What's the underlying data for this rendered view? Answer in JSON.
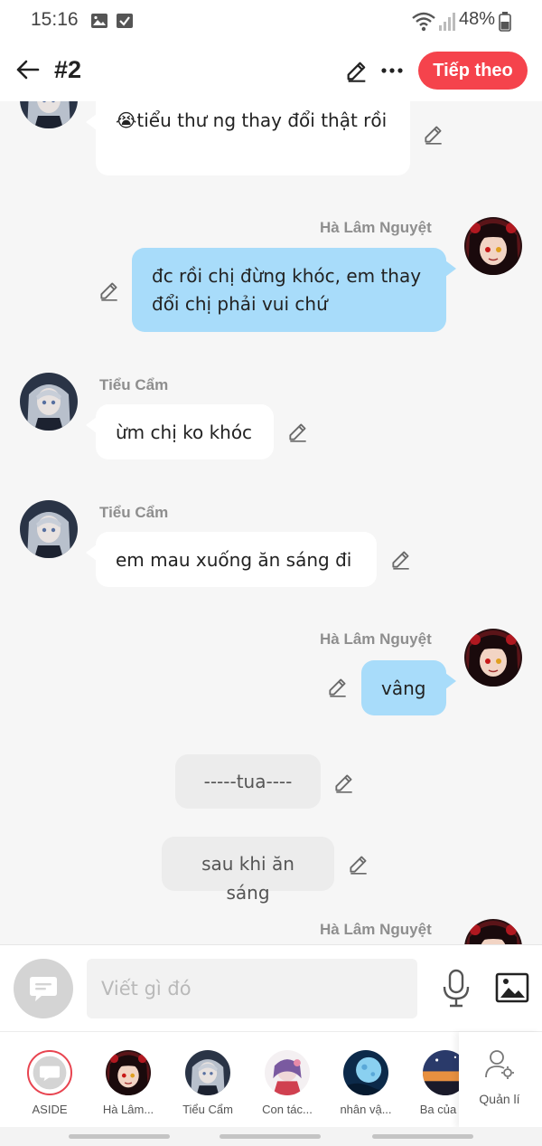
{
  "status_bar": {
    "time": "15:16",
    "battery": "48%"
  },
  "header": {
    "title": "#2",
    "next_label": "Tiếp theo"
  },
  "messages": [
    {
      "type": "left",
      "speaker": "",
      "text": "😭tiểu thư ng thay đổi thật rồi"
    },
    {
      "type": "right",
      "speaker": "Hà Lâm Nguyệt",
      "text": "đc rồi chị đừng khóc, em thay đổi chị phải vui chứ"
    },
    {
      "type": "left",
      "speaker": "Tiểu Cẩm",
      "text": "ừm chị ko khóc"
    },
    {
      "type": "left",
      "speaker": "Tiểu Cẩm",
      "text": "em mau xuống ăn sáng đi"
    },
    {
      "type": "right",
      "speaker": "Hà Lâm Nguyệt",
      "text": "vâng"
    },
    {
      "type": "narration",
      "text": "-----tua----"
    },
    {
      "type": "narration",
      "text": "sau khi ăn sáng"
    },
    {
      "type": "right",
      "speaker": "Hà Lâm Nguyệt",
      "text": ""
    }
  ],
  "composer": {
    "placeholder": "Viết gì đó"
  },
  "characters": [
    {
      "label": "ASIDE",
      "icon": "aside-icon"
    },
    {
      "label": "Hà Lâm...",
      "icon": "ha-lam-nguyet-avatar"
    },
    {
      "label": "Tiểu Cẩm",
      "icon": "tieu-cam-avatar"
    },
    {
      "label": "Con tác...",
      "icon": "con-tac-avatar"
    },
    {
      "label": "nhân vậ...",
      "icon": "nhan-vat-avatar"
    },
    {
      "label": "Ba của",
      "icon": "ba-cua-avatar"
    },
    {
      "label": "Quản lí",
      "icon": "manage-user-icon"
    }
  ],
  "colors": {
    "accent": "#f5434c",
    "bubble_right": "#a8dcfa",
    "bubble_left": "#ffffff",
    "narration": "#ececec"
  }
}
